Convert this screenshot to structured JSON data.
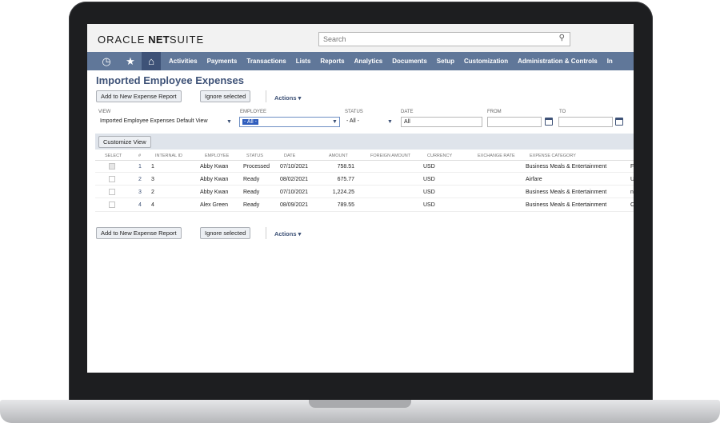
{
  "header": {
    "logo_light": "ORACLE",
    "logo_bold": "NET",
    "logo_rest": "SUITE",
    "search_placeholder": "Search"
  },
  "nav": {
    "icons": [
      "recent-icon",
      "star-icon",
      "home-icon"
    ],
    "items": [
      "Activities",
      "Payments",
      "Transactions",
      "Lists",
      "Reports",
      "Analytics",
      "Documents",
      "Setup",
      "Customization",
      "Administration & Controls",
      "In"
    ]
  },
  "page": {
    "title": "Imported Employee Expenses",
    "add_button": "Add to New Expense Report",
    "ignore_button": "Ignore selected",
    "actions_label": "Actions ▾"
  },
  "filters": {
    "view_label": "VIEW",
    "view_value": "Imported Employee Expenses Default View",
    "employee_label": "EMPLOYEE",
    "employee_value": "- All -",
    "status_label": "STATUS",
    "status_value": "- All -",
    "date_label": "DATE",
    "date_value": "All",
    "from_label": "FROM",
    "to_label": "TO"
  },
  "list": {
    "customize_button": "Customize View",
    "columns": [
      "SELECT",
      "#",
      "INTERNAL ID",
      "EMPLOYEE",
      "STATUS",
      "DATE",
      "AMOUNT",
      "FOREIGN AMOUNT",
      "CURRENCY",
      "EXCHANGE RATE",
      "EXPENSE CATEGORY"
    ],
    "rows": [
      {
        "num": "1",
        "id": "1",
        "employee": "Abby Kwan",
        "status": "Processed",
        "date": "07/10/2021",
        "amount": "758.51",
        "currency": "USD",
        "category": "Business Meals & Entertainment",
        "cut": "F",
        "disabled": true
      },
      {
        "num": "2",
        "id": "3",
        "employee": "Abby Kwan",
        "status": "Ready",
        "date": "08/02/2021",
        "amount": "675.77",
        "currency": "USD",
        "category": "Airfare",
        "cut": "U",
        "disabled": false
      },
      {
        "num": "3",
        "id": "2",
        "employee": "Abby Kwan",
        "status": "Ready",
        "date": "07/10/2021",
        "amount": "1,224.25",
        "currency": "USD",
        "category": "Business Meals & Entertainment",
        "cut": "n",
        "disabled": false
      },
      {
        "num": "4",
        "id": "4",
        "employee": "Alex Green",
        "status": "Ready",
        "date": "08/09/2021",
        "amount": "789.55",
        "currency": "USD",
        "category": "Business Meals & Entertainment",
        "cut": "C",
        "disabled": false
      }
    ]
  },
  "colors": {
    "nav_bg": "#607799",
    "nav_home_bg": "#3e5277",
    "title_color": "#3e5277",
    "band_bg": "#dfe4eb",
    "selected_highlight": "#2f5dbd"
  }
}
